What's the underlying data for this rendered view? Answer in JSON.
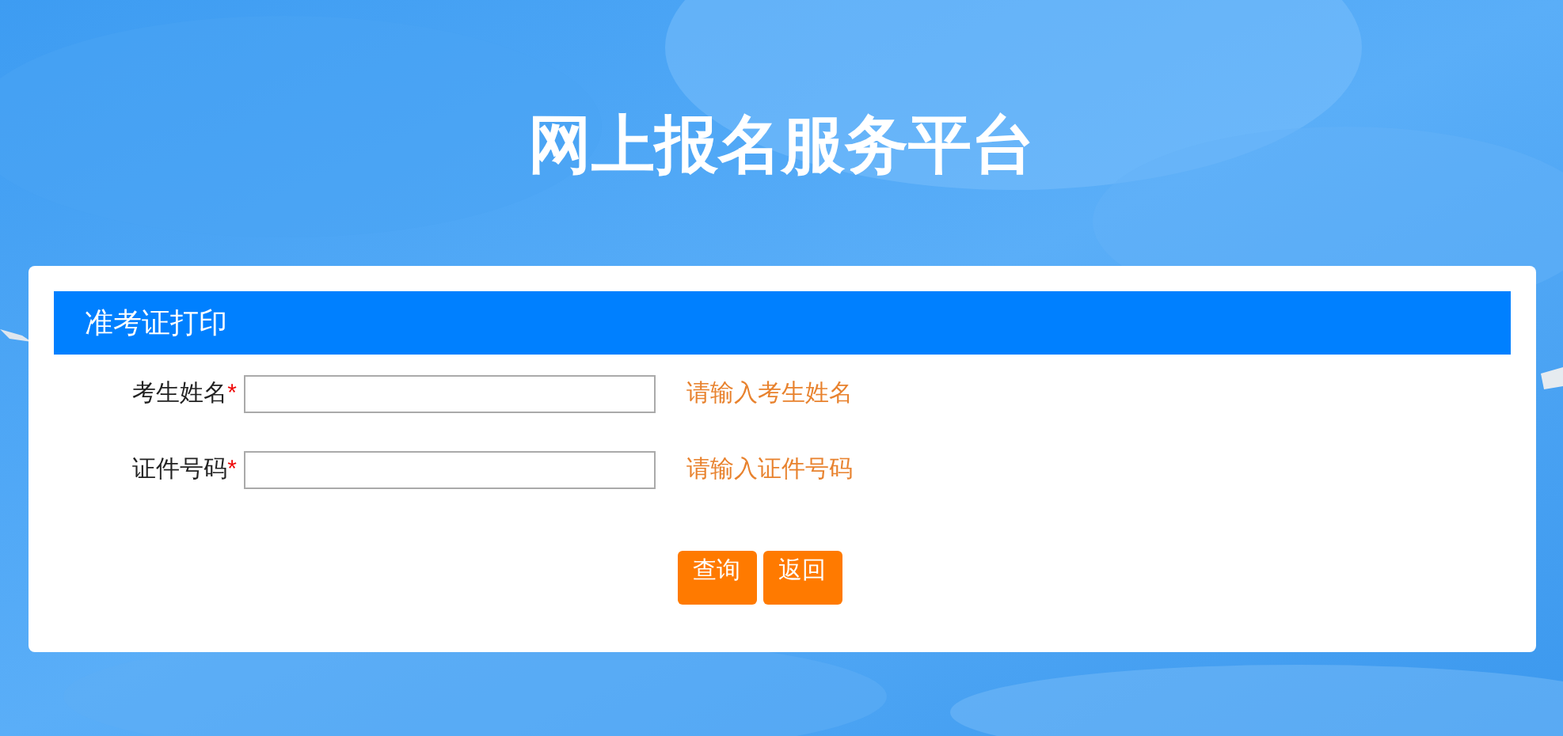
{
  "page_title": "网上报名服务平台",
  "panel": {
    "title": "准考证打印",
    "fields": [
      {
        "label": "考生姓名",
        "required_mark": "*",
        "hint": "请输入考生姓名"
      },
      {
        "label": "证件号码",
        "required_mark": "*",
        "hint": "请输入证件号码"
      }
    ],
    "buttons": [
      "查询",
      "返回"
    ]
  }
}
